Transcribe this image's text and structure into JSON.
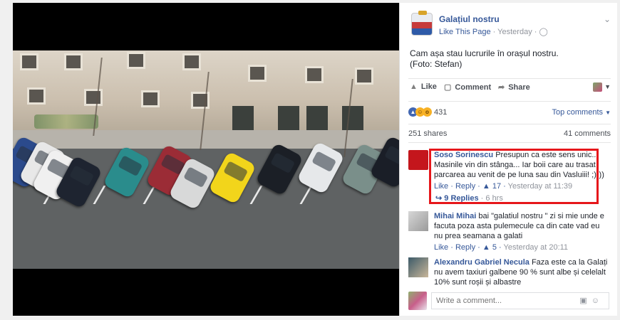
{
  "post": {
    "page_name": "Galațiul nostru",
    "like_page": "Like This Page",
    "time": "Yesterday",
    "text_line1": "Cam așa stau lucrurile în orașul nostru.",
    "text_line2": "(Foto: Stefan)"
  },
  "actions": {
    "like": "Like",
    "comment": "Comment",
    "share": "Share"
  },
  "reactions": {
    "count": "431",
    "sort": "Top comments"
  },
  "stats": {
    "shares": "251 shares",
    "comments": "41 comments"
  },
  "comments": [
    {
      "author": "Soso Sorinescu",
      "text": "Presupun ca este sens unic... Masinile vin din stânga... Iar boii care au trasat parcarea au venit de pe luna sau din Vasluiii! ;))))",
      "like": "Like",
      "reply": "Reply",
      "likes": "17",
      "time": "Yesterday at 11:39",
      "replies": "9 Replies",
      "replies_time": "6 hrs"
    },
    {
      "author": "Mihai Mihai",
      "text": "bai \"galatiul nostru \" zi si mie unde e facuta poza asta pulemecule ca din cate vad eu nu prea seamana a galati",
      "like": "Like",
      "reply": "Reply",
      "likes": "5",
      "time": "Yesterday at 20:11"
    },
    {
      "author": "Alexandru Gabriel Necula",
      "text": "Faza este ca la Galați nu avem taxiuri galbene 90 % sunt albe și celelalt 10% sunt roșii și albastre"
    }
  ],
  "write": {
    "placeholder": "Write a comment..."
  },
  "icons": {
    "menu": "chevron-down-icon",
    "globe": "globe-icon",
    "like": "thumbs-up-icon",
    "comment": "speech-bubble-icon",
    "share": "share-arrow-icon",
    "camera": "camera-icon",
    "emoji": "smiley-icon"
  },
  "colors": {
    "link": "#365899",
    "highlight": "#e6171b",
    "taxi": "#f2d51b"
  }
}
